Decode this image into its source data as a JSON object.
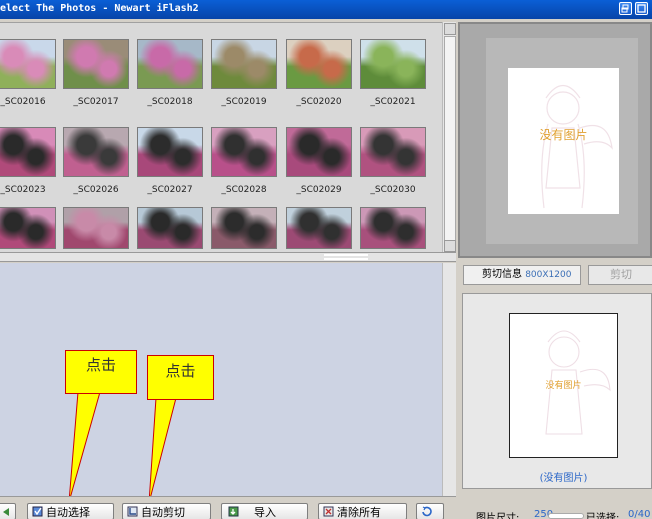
{
  "window": {
    "title": "elect The Photos - Newart iFlash2"
  },
  "thumbnails": [
    {
      "caption": "_SC02016",
      "palette": [
        "#8fb05a",
        "#d98bb8",
        "#c9d8ea"
      ]
    },
    {
      "caption": "_SC02017",
      "palette": [
        "#6f8f4a",
        "#d07ab0",
        "#9a8c78"
      ]
    },
    {
      "caption": "_SC02018",
      "palette": [
        "#7a9a52",
        "#c86aa8",
        "#a6b8c8"
      ]
    },
    {
      "caption": "_SC02019",
      "palette": [
        "#6e8a3c",
        "#9c8a68",
        "#c8d6e4"
      ]
    },
    {
      "caption": "_SC02020",
      "palette": [
        "#6a9a42",
        "#c76a4a",
        "#dcd0c0"
      ]
    },
    {
      "caption": "_SC02021",
      "palette": [
        "#5e8c3a",
        "#8ab45a",
        "#cfe0ea"
      ]
    },
    {
      "caption": "_SC02023",
      "palette": [
        "#b04a7a",
        "#2a2a2a",
        "#d88ab8"
      ]
    },
    {
      "caption": "_SC02026",
      "palette": [
        "#c06090",
        "#3a3a3a",
        "#b8a8b0"
      ]
    },
    {
      "caption": "_SC02027",
      "palette": [
        "#a8487a",
        "#2c2c2c",
        "#c8d8e8"
      ]
    },
    {
      "caption": "_SC02028",
      "palette": [
        "#b8508a",
        "#303030",
        "#d8a0c0"
      ]
    },
    {
      "caption": "_SC02029",
      "palette": [
        "#a84a7c",
        "#2a2a2a",
        "#c06a98"
      ]
    },
    {
      "caption": "_SC02030",
      "palette": [
        "#b05280",
        "#343434",
        "#d89ab8"
      ]
    },
    {
      "caption": "",
      "palette": [
        "#b04a7a",
        "#2a2a2a",
        "#d090b8"
      ]
    },
    {
      "caption": "",
      "palette": [
        "#a0486e",
        "#c88aa8",
        "#b0a0a8"
      ]
    },
    {
      "caption": "",
      "palette": [
        "#9a4a72",
        "#2a2a2a",
        "#b6c8d6"
      ]
    },
    {
      "caption": "",
      "palette": [
        "#8a5a6a",
        "#2c2c2c",
        "#c4b0b8"
      ]
    },
    {
      "caption": "",
      "palette": [
        "#9c4a74",
        "#303030",
        "#c0d0dc"
      ]
    },
    {
      "caption": "",
      "palette": [
        "#a8507c",
        "#2e2e2e",
        "#cc98b6"
      ]
    }
  ],
  "callouts": {
    "auto_select": "点击",
    "auto_crop": "点击"
  },
  "bottom_buttons": {
    "auto_select": "自动选择",
    "auto_crop": "自动剪切",
    "import": "导入",
    "clear_all": "清除所有"
  },
  "preview": {
    "no_image": "没有图片"
  },
  "crop": {
    "info_label": "剪切信息",
    "size": "800X1200",
    "button": "剪切"
  },
  "small_preview": {
    "no_image": "没有图片",
    "caption": "(没有图片)"
  },
  "status": {
    "size_label": "图片尺寸:",
    "size_value": "250",
    "selected_label": "已选择:",
    "selected_value": "0/40"
  },
  "colors": {
    "titlebar": "#0a5fd6",
    "work_area": "#cdd3e3",
    "callout_fill": "#ffff00",
    "callout_border": "#cc0000",
    "link_blue": "#2a66c8",
    "nopic_text": "#e0a030"
  }
}
